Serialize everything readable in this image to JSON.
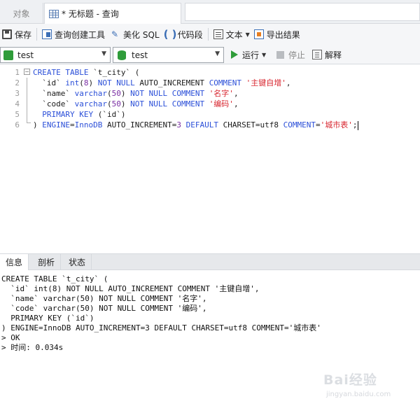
{
  "tabs": {
    "objects_label": "对象",
    "query_label": "* 无标题 - 查询"
  },
  "toolbar": {
    "save_label": "保存",
    "query_builder_label": "查询创建工具",
    "beautify_label": "美化 SQL",
    "snippet_label": "代码段",
    "text_label": "文本",
    "export_label": "导出结果"
  },
  "connection_bar": {
    "connection_value": "test",
    "database_value": "test",
    "run_label": "运行",
    "stop_label": "停止",
    "explain_label": "解释"
  },
  "editor": {
    "line_numbers": [
      "1",
      "2",
      "3",
      "4",
      "5",
      "6"
    ],
    "lines": [
      [
        {
          "t": "CREATE TABLE",
          "c": "kw"
        },
        {
          "t": " `t_city` (",
          "c": ""
        }
      ],
      [
        {
          "t": "  `id` ",
          "c": ""
        },
        {
          "t": "int",
          "c": "kw"
        },
        {
          "t": "(",
          "c": ""
        },
        {
          "t": "8",
          "c": "num"
        },
        {
          "t": ") ",
          "c": ""
        },
        {
          "t": "NOT NULL",
          "c": "kw"
        },
        {
          "t": " AUTO_INCREMENT ",
          "c": ""
        },
        {
          "t": "COMMENT",
          "c": "kw"
        },
        {
          "t": " ",
          "c": ""
        },
        {
          "t": "'主键自增'",
          "c": "str"
        },
        {
          "t": ",",
          "c": ""
        }
      ],
      [
        {
          "t": "  `name` ",
          "c": ""
        },
        {
          "t": "varchar",
          "c": "kw"
        },
        {
          "t": "(",
          "c": ""
        },
        {
          "t": "50",
          "c": "num"
        },
        {
          "t": ") ",
          "c": ""
        },
        {
          "t": "NOT NULL",
          "c": "kw"
        },
        {
          "t": " ",
          "c": ""
        },
        {
          "t": "COMMENT",
          "c": "kw"
        },
        {
          "t": " ",
          "c": ""
        },
        {
          "t": "'名字'",
          "c": "str"
        },
        {
          "t": ",",
          "c": ""
        }
      ],
      [
        {
          "t": "  `code` ",
          "c": ""
        },
        {
          "t": "varchar",
          "c": "kw"
        },
        {
          "t": "(",
          "c": ""
        },
        {
          "t": "50",
          "c": "num"
        },
        {
          "t": ") ",
          "c": ""
        },
        {
          "t": "NOT NULL",
          "c": "kw"
        },
        {
          "t": " ",
          "c": ""
        },
        {
          "t": "COMMENT",
          "c": "kw"
        },
        {
          "t": " ",
          "c": ""
        },
        {
          "t": "'编码'",
          "c": "str"
        },
        {
          "t": ",",
          "c": ""
        }
      ],
      [
        {
          "t": "  ",
          "c": ""
        },
        {
          "t": "PRIMARY KEY",
          "c": "kw"
        },
        {
          "t": " (`id`)",
          "c": ""
        }
      ],
      [
        {
          "t": ") ",
          "c": ""
        },
        {
          "t": "ENGINE",
          "c": "kw"
        },
        {
          "t": "=",
          "c": ""
        },
        {
          "t": "InnoDB",
          "c": "kw"
        },
        {
          "t": " AUTO_INCREMENT=",
          "c": ""
        },
        {
          "t": "3",
          "c": "num"
        },
        {
          "t": " ",
          "c": ""
        },
        {
          "t": "DEFAULT",
          "c": "kw"
        },
        {
          "t": " CHARSET=utf8 ",
          "c": ""
        },
        {
          "t": "COMMENT",
          "c": "kw"
        },
        {
          "t": "=",
          "c": ""
        },
        {
          "t": "'城市表'",
          "c": "str"
        },
        {
          "t": ";",
          "c": ""
        }
      ]
    ]
  },
  "result_tabs": {
    "info_label": "信息",
    "profile_label": "剖析",
    "status_label": "状态"
  },
  "output": {
    "lines": [
      "CREATE TABLE `t_city` (",
      "  `id` int(8) NOT NULL AUTO_INCREMENT COMMENT '主键自增',",
      "  `name` varchar(50) NOT NULL COMMENT '名字',",
      "  `code` varchar(50) NOT NULL COMMENT '编码',",
      "  PRIMARY KEY (`id`)",
      ") ENGINE=InnoDB AUTO_INCREMENT=3 DEFAULT CHARSET=utf8 COMMENT='城市表'",
      "> OK",
      "> 时间: 0.034s"
    ]
  },
  "watermark": {
    "logo": "Bai经验",
    "url": "jingyan.baidu.com"
  }
}
